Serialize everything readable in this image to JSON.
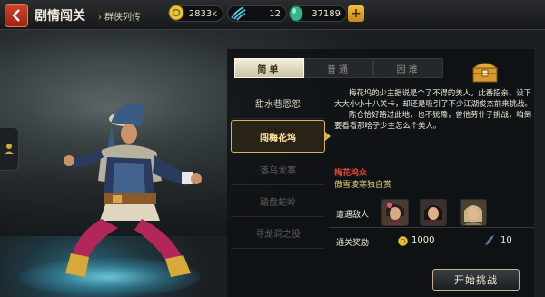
{
  "header": {
    "title": "剧情闯关",
    "subtitle": "群侠列传",
    "separator": "›",
    "resources": [
      {
        "name": "coins",
        "icon": "gold-coin-icon",
        "value": "2833k"
      },
      {
        "name": "energy",
        "icon": "claw-icon",
        "value": "12"
      },
      {
        "name": "jade",
        "icon": "jade-icon",
        "value": "37189"
      }
    ],
    "plus": "+"
  },
  "difficulty_tabs": [
    {
      "label": "简单",
      "active": true
    },
    {
      "label": "普通",
      "active": false
    },
    {
      "label": "困难",
      "active": false
    }
  ],
  "stages": [
    {
      "label": "甜水巷恩怨",
      "state": "done"
    },
    {
      "label": "闯梅花坞",
      "state": "active"
    },
    {
      "label": "落乌龙寨",
      "state": "locked"
    },
    {
      "label": "踏盘蛇岭",
      "state": "locked"
    },
    {
      "label": "寻龙洞之役",
      "state": "locked"
    }
  ],
  "description": {
    "para1": "梅花坞的少主据说是个了不得的美人，此番招亲，设下大大小小十八关卡，却还是吸引了不少江湖俊杰前来挑战。",
    "para2": "陈仓恰好路过此地，也不犹豫，曾他劳什子挑战，咱倒要看看那啥子少主怎么个美人。"
  },
  "boss": {
    "name": "梅花坞众",
    "tag": "傲雪凌寒独自赏"
  },
  "enemies_label": "遭遇敌人",
  "enemies": [
    {
      "icon": "enemy-portrait-1"
    },
    {
      "icon": "enemy-portrait-2"
    },
    {
      "icon": "enemy-portrait-3"
    }
  ],
  "rewards_label": "通关奖励",
  "rewards": {
    "coins": "1000",
    "exp": "10"
  },
  "start_button": "开始挑战",
  "colors": {
    "accent_gold": "#d8b25a",
    "boss_red": "#e44a34",
    "back_red": "#c23a22"
  }
}
